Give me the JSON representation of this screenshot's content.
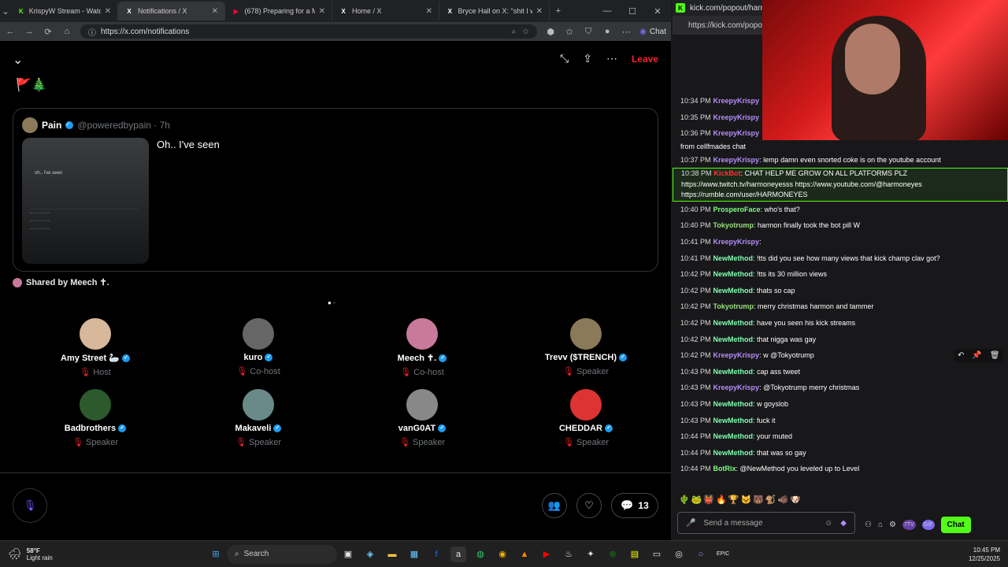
{
  "left_browser": {
    "tabs": [
      {
        "label": "KrispyW Stream - Watch Liv",
        "color": "#53fc18",
        "glyph": "K"
      },
      {
        "label": "Notifications / X",
        "color": "#ffffff",
        "glyph": "X"
      },
      {
        "label": "(678) Preparing for a M",
        "color": "#ff0033",
        "glyph": "▶"
      },
      {
        "label": "Home / X",
        "color": "#ffffff",
        "glyph": "X"
      },
      {
        "label": "Bryce Hall on X: \"shit I was",
        "color": "#ffffff",
        "glyph": "X"
      }
    ],
    "url": "https://x.com/notifications",
    "chat_label": "Chat"
  },
  "space": {
    "leave_label": "Leave",
    "emojis": "🚩🎄",
    "post": {
      "name": "Pain",
      "handle": "@poweredbypain · 7h",
      "text": "Oh.. I've seen",
      "thumb_text": "oh.. i've seen"
    },
    "shared_by": "Shared by Meech ✝.",
    "people": [
      {
        "name": "Amy Street 🦢",
        "role": "Host",
        "color": "#d8b89a",
        "role_color": "#71767b"
      },
      {
        "name": "kuro",
        "role": "Co-host",
        "color": "#666",
        "role_color": "#71767b"
      },
      {
        "name": "Meech ✝.",
        "role": "Co-host",
        "color": "#c97a9a",
        "role_color": "#71767b"
      },
      {
        "name": "Trevv ($TRENCH)",
        "role": "Speaker",
        "color": "#8a7a5a",
        "role_color": "#71767b"
      },
      {
        "name": "Badbrothers",
        "role": "Speaker",
        "color": "#2c5a2c",
        "role_color": "#71767b"
      },
      {
        "name": "Makaveli",
        "role": "Speaker",
        "color": "#6a8a8a",
        "role_color": "#71767b"
      },
      {
        "name": "vanG0AT",
        "role": "Speaker",
        "color": "#888",
        "role_color": "#71767b"
      },
      {
        "name": "CHEDDAR",
        "role": "Speaker",
        "color": "#d33",
        "role_color": "#71767b"
      }
    ],
    "comment_count": "13"
  },
  "kick": {
    "title": "kick.com/popout/harm",
    "url": "https://kick.com/popo",
    "messages": [
      {
        "ts": "10:34 PM",
        "user": "KreepyKrispy",
        "color": "#b58dfa",
        "text": ""
      },
      {
        "ts": "10:35 PM",
        "user": "KreepyKrispy",
        "color": "#b58dfa",
        "text": ""
      },
      {
        "ts": "10:36 PM",
        "user": "KreepyKrispy",
        "color": "#b58dfa",
        "text": ""
      },
      {
        "ts": "",
        "user": "",
        "color": "#fff",
        "text": "from cellfmades chat"
      },
      {
        "ts": "10:37 PM",
        "user": "KreepyKrispy",
        "color": "#b58dfa",
        "text": ": lemp damn even snorted coke is on the youtube account"
      },
      {
        "ts": "10:38 PM",
        "user": "KickBot",
        "color": "#ff3333",
        "text": ": CHAT HELP ME GROW ON ALL PLATFORMS PLZ"
      },
      {
        "ts": "",
        "user": "",
        "color": "#fff",
        "text": "https://www.twitch.tv/harmoneyesss https://www.youtube.com/@harmoneyes"
      },
      {
        "ts": "",
        "user": "",
        "color": "#fff",
        "text": "https://rumble.com/user/HARMONEYES"
      },
      {
        "ts": "10:40 PM",
        "user": "ProsperoFace",
        "color": "#7dff7d",
        "text": ": who's that?"
      },
      {
        "ts": "10:40 PM",
        "user": "Tokyotrump",
        "color": "#9ae07a",
        "text": ": harmon finally took the bot pill W"
      },
      {
        "ts": "10:41 PM",
        "user": "KreepyKrispy",
        "color": "#b58dfa",
        "text": ":"
      },
      {
        "ts": "10:41 PM",
        "user": "NewMethod",
        "color": "#7dffb0",
        "text": ": !tts did you see how many views that kick champ clav got?"
      },
      {
        "ts": "10:42 PM",
        "user": "NewMethod",
        "color": "#7dffb0",
        "text": ": !tts its 30 million views"
      },
      {
        "ts": "10:42 PM",
        "user": "NewMethod",
        "color": "#7dffb0",
        "text": ": thats so cap"
      },
      {
        "ts": "10:42 PM",
        "user": "Tokyotrump",
        "color": "#9ae07a",
        "text": ": merry christmas harmon and tammer"
      },
      {
        "ts": "10:42 PM",
        "user": "NewMethod",
        "color": "#7dffb0",
        "text": ": have you seen his kick streams"
      },
      {
        "ts": "10:42 PM",
        "user": "NewMethod",
        "color": "#7dffb0",
        "text": ": that nigga was gay"
      },
      {
        "ts": "10:42 PM",
        "user": "KreepyKrispy",
        "color": "#b58dfa",
        "text": ": w @Tokyotrump"
      },
      {
        "ts": "10:43 PM",
        "user": "NewMethod",
        "color": "#7dffb0",
        "text": ": cap ass tweet"
      },
      {
        "ts": "10:43 PM",
        "user": "KreepyKrispy",
        "color": "#b58dfa",
        "text": ": @Tokyotrump merry christmas"
      },
      {
        "ts": "10:43 PM",
        "user": "NewMethod",
        "color": "#7dffb0",
        "text": ": w goyslob"
      },
      {
        "ts": "10:43 PM",
        "user": "NewMethod",
        "color": "#7dffb0",
        "text": ": fuck it"
      },
      {
        "ts": "10:44 PM",
        "user": "NewMethod",
        "color": "#7dffb0",
        "text": ": your muted"
      },
      {
        "ts": "10:44 PM",
        "user": "NewMethod",
        "color": "#7dffb0",
        "text": ": that was so gay"
      },
      {
        "ts": "10:44 PM",
        "user": "BotRix",
        "color": "#7dff7d",
        "text": ": @NewMethod you leveled up to Level"
      }
    ],
    "input_placeholder": "Send a message",
    "chat_button": "Chat"
  },
  "taskbar": {
    "weather_temp": "58°F",
    "weather_desc": "Light rain",
    "search": "Search",
    "time": "10:45 PM",
    "date": "12/25/2025"
  }
}
